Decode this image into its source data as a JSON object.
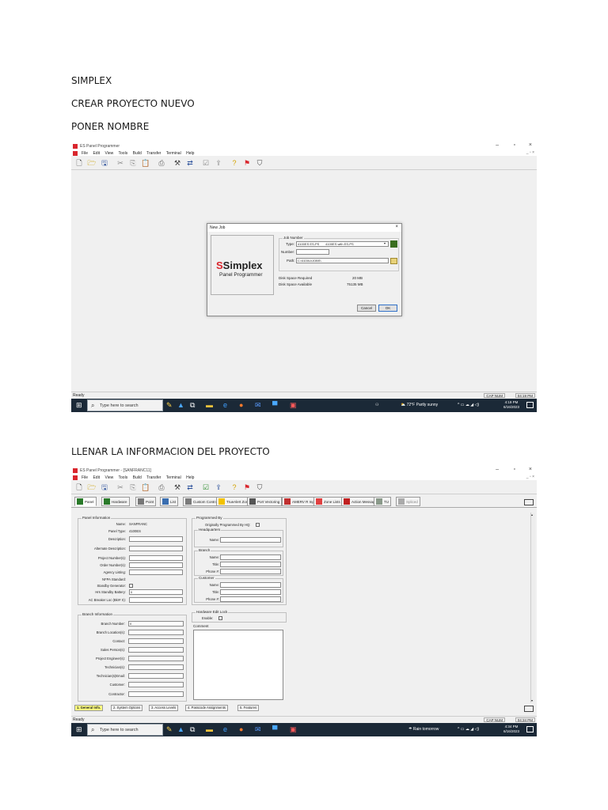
{
  "doc": {
    "heading1": "SIMPLEX",
    "heading2": "CREAR PROYECTO NUEVO",
    "heading3": "PONER NOMBRE",
    "heading4": "LLENAR LA INFORMACION DEL PROYECTO"
  },
  "colors": {
    "brand_red": "#d9262d",
    "taskbar": "#1b2937",
    "active_tab": "#ffff80"
  },
  "shot1": {
    "title": "ES Panel Programmer",
    "menu": [
      "File",
      "Edit",
      "View",
      "Tools",
      "Build",
      "Transfer",
      "Terminal",
      "Help"
    ],
    "dialog": {
      "title": "New Job",
      "close": "×",
      "logo": {
        "mark": "S",
        "word": "Simplex",
        "sub": "Panel Programmer"
      },
      "group": "Job Number",
      "type_label": "Type:",
      "type_value": "4100ES ES-PS",
      "type_value2": "4100ES with ES-PS",
      "number_label": "Number:",
      "number_value": "",
      "path_label": "Path:",
      "path_value": "C:\\4100U\\JOBS\\",
      "disk_req_label": "Disk Space Required",
      "disk_req_value": "20 MB",
      "disk_avail_label": "Disk Space Available",
      "disk_avail_value": "75135 MB",
      "cancel": "Cancel",
      "ok": "OK"
    },
    "status": {
      "ready": "Ready",
      "caps": "CAP NUM",
      "time": "04:19 PM"
    },
    "taskbar": {
      "search": "Type here to search",
      "weather": "72°F  Partly sunny",
      "clock_time": "4:19 PM",
      "clock_date": "6/16/2023"
    }
  },
  "shot2": {
    "title": "ES Panel Programmer - [SANFRANC11]",
    "menu": [
      "File",
      "Edit",
      "View",
      "Tools",
      "Build",
      "Transfer",
      "Terminal",
      "Help"
    ],
    "tabs": [
      "Panel",
      "Hardware",
      "Point",
      "List",
      "Custom Control",
      "TrueAlert Zone",
      "Port Vectoring",
      "AMERV R Input",
      "Zone Lists",
      "Action Message",
      "TU",
      "Spliced"
    ],
    "panel_info": {
      "legend": "Panel Information",
      "name_label": "Name:",
      "name_value": "SANFRANC",
      "type_label": "Panel Type:",
      "type_value": "4100ES",
      "description": "Description:",
      "alternate": "Alternate Description:",
      "project": "Project Number(s):",
      "order": "Order Number(s):",
      "agency": "Agency Listing:",
      "nfpa": "NFPA Standard:",
      "standby_gen": "Standby Generator:",
      "hrs_standby": "Hrs Standby Battery:",
      "hrs_standby_value": "0",
      "ac_breaker": "AC Breaker Loc (Bkr# X):"
    },
    "branch_info": {
      "legend": "Branch Information",
      "number_label": "Branch Number:",
      "number_value": "0",
      "location": "Branch Location(s):",
      "contact": "Contact:",
      "sales": "Sales Person(s):",
      "engineer": "Project Engineer(s):",
      "technician": "Technician(s):",
      "tech_email": "Technician(s)Email:",
      "customer": "Customer:",
      "contractor": "Contractor:"
    },
    "programmed_by": {
      "legend": "Programmed By",
      "original": "Originally Programmed By HQ:",
      "hq": "Headquarters",
      "branch": "Branch",
      "customer": "Customer",
      "name": "Name:",
      "title": "Title:",
      "phone": "Phone #:"
    },
    "hw_edit": {
      "legend": "Hardware Edit Lock",
      "enable": "Enable:"
    },
    "comment": "Comment",
    "bottom_tabs": [
      "1. General Info.",
      "2. System Options",
      "3. Access Levels",
      "4. Passcode Assignments",
      "5. Features"
    ],
    "status": {
      "ready": "Ready",
      "caps": "CAP NUM",
      "time": "04:34 PM"
    },
    "taskbar": {
      "search": "Type here to search",
      "weather": "Rain tomorrow",
      "clock_time": "4:34 PM",
      "clock_date": "6/16/2023"
    }
  }
}
